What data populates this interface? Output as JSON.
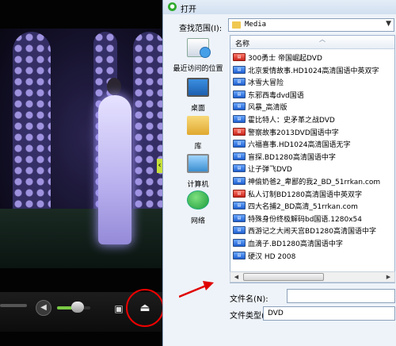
{
  "dialog": {
    "title": "打开",
    "look_in_label": "查找范围(I):",
    "look_in_value": "Media",
    "column_name": "名称",
    "file_name_label": "文件名(N):",
    "file_name_value": "",
    "file_type_label": "文件类型(T):",
    "file_type_value": "DVD"
  },
  "places": [
    {
      "label": "最近访问的位置",
      "icon": "recent-places-icon"
    },
    {
      "label": "桌面",
      "icon": "desktop-icon"
    },
    {
      "label": "库",
      "icon": "libraries-icon"
    },
    {
      "label": "计算机",
      "icon": "computer-icon"
    },
    {
      "label": "网络",
      "icon": "network-icon"
    }
  ],
  "files": [
    {
      "name": "300勇士 帝国崛起DVD",
      "icon": "red"
    },
    {
      "name": "北京爱情故事.HD1024高清国语中英双字",
      "icon": "blue"
    },
    {
      "name": "冰雪大冒险",
      "icon": "blue"
    },
    {
      "name": "东邪西毒dvd国语",
      "icon": "blue"
    },
    {
      "name": "风暴_高清版",
      "icon": "blue"
    },
    {
      "name": "霍比特人：史矛革之战DVD",
      "icon": "blue"
    },
    {
      "name": "警察故事2013DVD国语中字",
      "icon": "red"
    },
    {
      "name": "六福喜事.HD1024高清国语无字",
      "icon": "blue"
    },
    {
      "name": "盲探.BD1280高清国语中字",
      "icon": "blue"
    },
    {
      "name": "让子弹飞DVD",
      "icon": "blue"
    },
    {
      "name": "神偷奶爸2_卑鄙的我2_BD_51rrkan.com",
      "icon": "blue"
    },
    {
      "name": "私人订制BD1280高清国语中英双字",
      "icon": "red"
    },
    {
      "name": "四大名捕2_BD高清_51rrkan.com",
      "icon": "blue"
    },
    {
      "name": "特殊身份终极解码bd国语.1280x54",
      "icon": "blue"
    },
    {
      "name": "西游记之大闹天宫BD1280高清国语中字",
      "icon": "blue"
    },
    {
      "name": "血滴子.BD1280高清国语中字",
      "icon": "blue"
    },
    {
      "name": "硬汉 HD 2008",
      "icon": "blue"
    }
  ],
  "colors": {
    "annotation_red": "#e00000",
    "dialog_bg": "#eef3f9",
    "volume_fill": "#7ac943"
  },
  "player": {
    "volume_level": 0.6
  }
}
